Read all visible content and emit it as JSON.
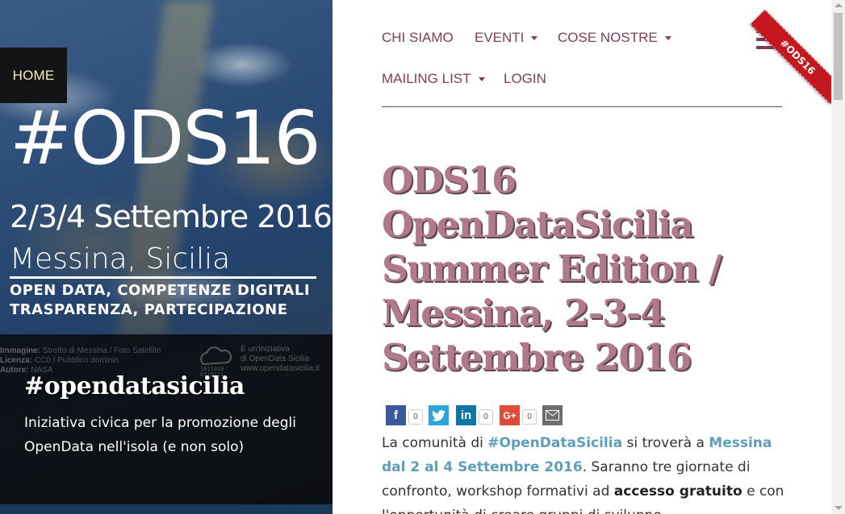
{
  "hero": {
    "home_label": "HOME",
    "title": "#ODS16",
    "dates": "2/3/4 Settembre 2016",
    "place": "Messina, Sicilia",
    "tagline_1": "OPEN DATA, COMPETENZE DIGITALI",
    "tagline_2": "TRASPARENZA, PARTECIPAZIONE",
    "credits_image_label": "Immagine:",
    "credits_image": " Stretto di Messina / Foto Satellite",
    "credits_license_label": "Licenza:",
    "credits_license": " CC0 / Pubblico dominio",
    "credits_author_label": "Autore:",
    "credits_author": " NASA",
    "credits_right_1": "È un'iniziativa",
    "credits_right_2": "di OpenData Sicilia",
    "credits_right_3": "www.opendatasicilia.it",
    "side_title": "#opendatasicilia",
    "side_desc": "Iniziativa civica per la promozione degli OpenData nell'isola (e non solo)"
  },
  "nav": {
    "chi_siamo": "CHI SIAMO",
    "eventi": "EVENTI",
    "cose_nostre": "COSE NOSTRE",
    "mailing_list": "MAILING LIST",
    "login": "LOGIN"
  },
  "ribbon": "#ODS16",
  "article": {
    "title": "ODS16 OpenDataSicilia Summer Edition / Messina, 2-3-4 Settembre 2016",
    "p1_a": "La comunità di ",
    "p1_link1": "#OpenDataSicilia",
    "p1_b": " si troverà a ",
    "p1_link2": "Messina dal 2 al 4 Settembre 2016",
    "p1_c": ". Saranno tre giornate di confronto, workshop formativi ad ",
    "p1_strong": "accesso gratuito",
    "p1_d": " e con l'opportunità di creare gruppi di sviluppo"
  },
  "share": {
    "facebook_count": "0",
    "linkedin_count": "0",
    "google_count": "0"
  },
  "colors": {
    "accent": "#7b3e57",
    "title": "#b07a8c",
    "link": "#5f9eb8",
    "ribbon": "#c3181f"
  }
}
